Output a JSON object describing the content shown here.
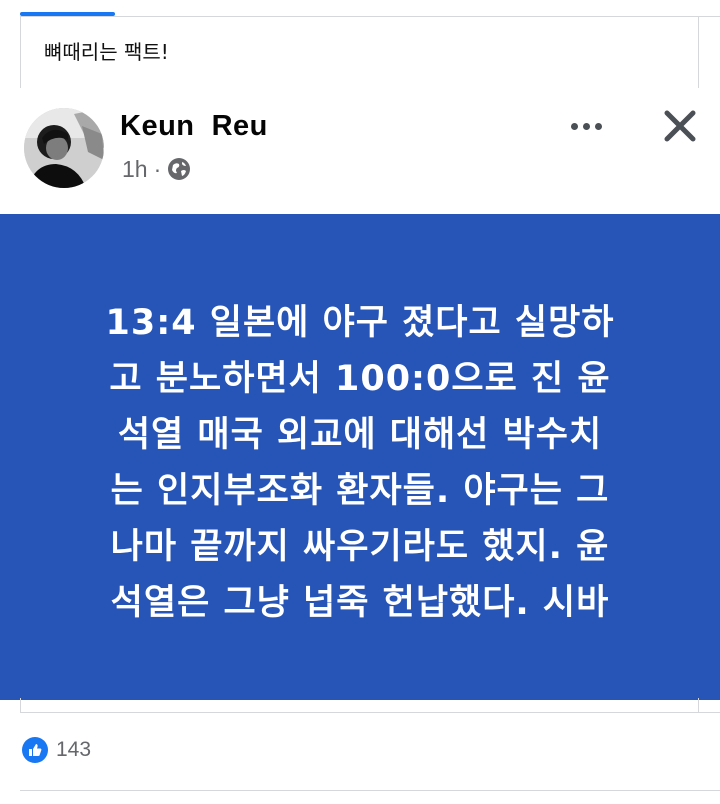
{
  "outer_post": {
    "caption": "뼈때리는 팩트!"
  },
  "shared_post": {
    "author": "Keun  Reu",
    "time": "1h",
    "separator": "·",
    "privacy_icon": "globe-icon",
    "more_icon": "more-options-icon",
    "close_icon": "close-icon",
    "card_background": "#2755b7",
    "card_text_lines": [
      "13:4 일본에 야구 졌다고 실망하",
      "고 분노하면서 100:0으로 진 윤",
      "석열 매국 외교에 대해선 박수치",
      "는 인지부조화 환자들. 야구는 그",
      "나마 끝까지 싸우기라도 했지. 윤",
      "석열은 그냥 넙죽 헌납했다. 시바"
    ]
  },
  "reactions": {
    "icon": "like-icon",
    "count": "143"
  },
  "colors": {
    "accent": "#1877f2",
    "meta_text": "#65676b"
  }
}
